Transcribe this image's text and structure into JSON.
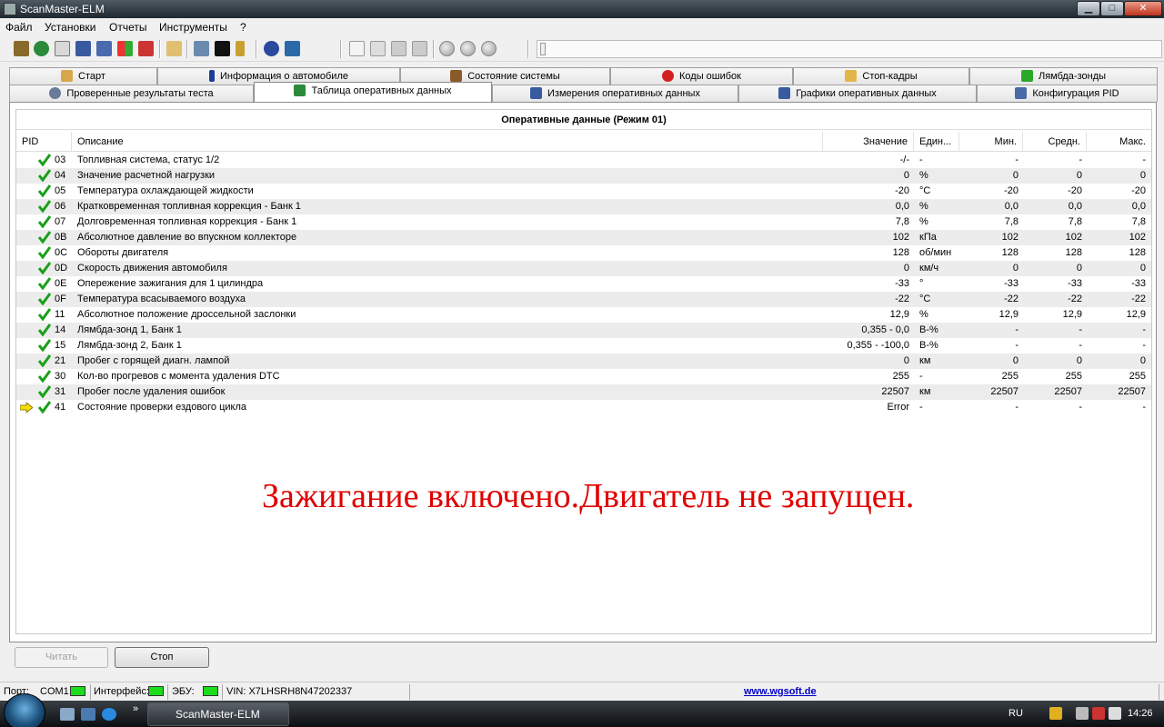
{
  "window": {
    "title": "ScanMaster-ELM",
    "minimize_glyph": "▁",
    "maximize_glyph": "□",
    "close_glyph": "✕"
  },
  "menu": [
    "Файл",
    "Установки",
    "Отчеты",
    "Инструменты",
    "?"
  ],
  "toolbar_icons": [
    "wrench-icon",
    "globe-icon",
    "document-icon",
    "table-icon",
    "chart-icon",
    "windows-icon",
    "traffic-light-icon",
    "clipboard-icon",
    "search-icon",
    "terminal-icon",
    "battery-icon",
    "info-icon",
    "plugin-icon",
    "new-icon",
    "open-icon",
    "save-icon",
    "print-icon",
    "play-icon",
    "stop-icon",
    "record-icon"
  ],
  "tabs_row1": [
    {
      "label": "Старт",
      "icon": "home-icon",
      "color": "#d8a64a"
    },
    {
      "label": "Информация о автомобиле",
      "icon": "info-icon",
      "color": "#1a3e9a"
    },
    {
      "label": "Состояние системы",
      "icon": "checklist-icon",
      "color": "#8a5a2a"
    },
    {
      "label": "Коды ошибок",
      "icon": "error-icon",
      "color": "#d42020"
    },
    {
      "label": "Стоп-кадры",
      "icon": "hand-icon",
      "color": "#e2b44a"
    },
    {
      "label": "Лямбда-зонды",
      "icon": "sensor-icon",
      "color": "#2aa82a"
    }
  ],
  "tabs_row2": [
    {
      "label": "Проверенные результаты теста",
      "icon": "gear-icon",
      "color": "#6a7a9a"
    },
    {
      "label": "Таблица оперативных данных",
      "icon": "table-icon",
      "color": "#2a8a3a"
    },
    {
      "label": "Измерения оперативных данных",
      "icon": "grid-icon",
      "color": "#3a5aa0"
    },
    {
      "label": "Графики оперативных данных",
      "icon": "chart-icon",
      "color": "#3a5aa0"
    },
    {
      "label": "Конфигурация PID",
      "icon": "config-icon",
      "color": "#4a6aa8"
    }
  ],
  "grid": {
    "title": "Оперативные данные (Режим 01)",
    "headers": {
      "pid": "PID",
      "desc": "Описание",
      "value": "Значение",
      "unit": "Един...",
      "min": "Мин.",
      "avg": "Средн.",
      "max": "Макс."
    },
    "rows": [
      {
        "pid": "03",
        "desc": "Топливная система, статус 1/2",
        "value": "-/-",
        "unit": "-",
        "min": "-",
        "avg": "-",
        "max": "-"
      },
      {
        "pid": "04",
        "desc": "Значение расчетной нагрузки",
        "value": "0",
        "unit": "%",
        "min": "0",
        "avg": "0",
        "max": "0"
      },
      {
        "pid": "05",
        "desc": "Температура охлаждающей жидкости",
        "value": "-20",
        "unit": "°C",
        "min": "-20",
        "avg": "-20",
        "max": "-20"
      },
      {
        "pid": "06",
        "desc": "Кратковременная топливная коррекция - Банк 1",
        "value": "0,0",
        "unit": "%",
        "min": "0,0",
        "avg": "0,0",
        "max": "0,0"
      },
      {
        "pid": "07",
        "desc": "Долговременная топливная коррекция - Банк 1",
        "value": "7,8",
        "unit": "%",
        "min": "7,8",
        "avg": "7,8",
        "max": "7,8"
      },
      {
        "pid": "0B",
        "desc": "Абсолютное давление во впускном коллекторе",
        "value": "102",
        "unit": "кПа",
        "min": "102",
        "avg": "102",
        "max": "102"
      },
      {
        "pid": "0C",
        "desc": "Обороты двигателя",
        "value": "128",
        "unit": "об/мин",
        "min": "128",
        "avg": "128",
        "max": "128"
      },
      {
        "pid": "0D",
        "desc": "Скорость движения автомобиля",
        "value": "0",
        "unit": "км/ч",
        "min": "0",
        "avg": "0",
        "max": "0"
      },
      {
        "pid": "0E",
        "desc": "Опережение зажигания для 1 цилиндра",
        "value": "-33",
        "unit": "°",
        "min": "-33",
        "avg": "-33",
        "max": "-33"
      },
      {
        "pid": "0F",
        "desc": "Температура  всасываемого воздуха",
        "value": "-22",
        "unit": "°C",
        "min": "-22",
        "avg": "-22",
        "max": "-22"
      },
      {
        "pid": "11",
        "desc": "Абсолютное положение дроссельной заслонки",
        "value": "12,9",
        "unit": "%",
        "min": "12,9",
        "avg": "12,9",
        "max": "12,9"
      },
      {
        "pid": "14",
        "desc": "Лямбда-зонд 1, Банк 1",
        "value": "0,355 - 0,0",
        "unit": "В-%",
        "min": "-",
        "avg": "-",
        "max": "-"
      },
      {
        "pid": "15",
        "desc": "Лямбда-зонд 2, Банк 1",
        "value": "0,355 - -100,0",
        "unit": "В-%",
        "min": "-",
        "avg": "-",
        "max": "-"
      },
      {
        "pid": "21",
        "desc": "Пробег с горящей диагн. лампой",
        "value": "0",
        "unit": "км",
        "min": "0",
        "avg": "0",
        "max": "0"
      },
      {
        "pid": "30",
        "desc": "Кол-во прогревов с момента удаления DTC",
        "value": "255",
        "unit": "-",
        "min": "255",
        "avg": "255",
        "max": "255"
      },
      {
        "pid": "31",
        "desc": "Пробег после удаления ошибок",
        "value": "22507",
        "unit": "км",
        "min": "22507",
        "avg": "22507",
        "max": "22507"
      },
      {
        "pid": "41",
        "desc": "Состояние проверки ездового цикла",
        "value": "Error",
        "unit": "-",
        "min": "-",
        "avg": "-",
        "max": "-",
        "current": true
      }
    ]
  },
  "overlay_text": "Зажигание включено.Двигатель не запущен.",
  "buttons": {
    "read": "Читать",
    "stop": "Стоп"
  },
  "status": {
    "port_label": "Порт:",
    "port_value": "COM1",
    "interface_label": "Интерфейс:",
    "ecu_label": "ЭБУ:",
    "vin": "VIN: X7LHSRH8N47202337",
    "website": "www.wgsoft.de",
    "led_color": "#1cdc1c"
  },
  "taskbar": {
    "task": "ScanMaster-ELM",
    "lang": "RU",
    "clock": "14:26",
    "overflow": "»"
  }
}
